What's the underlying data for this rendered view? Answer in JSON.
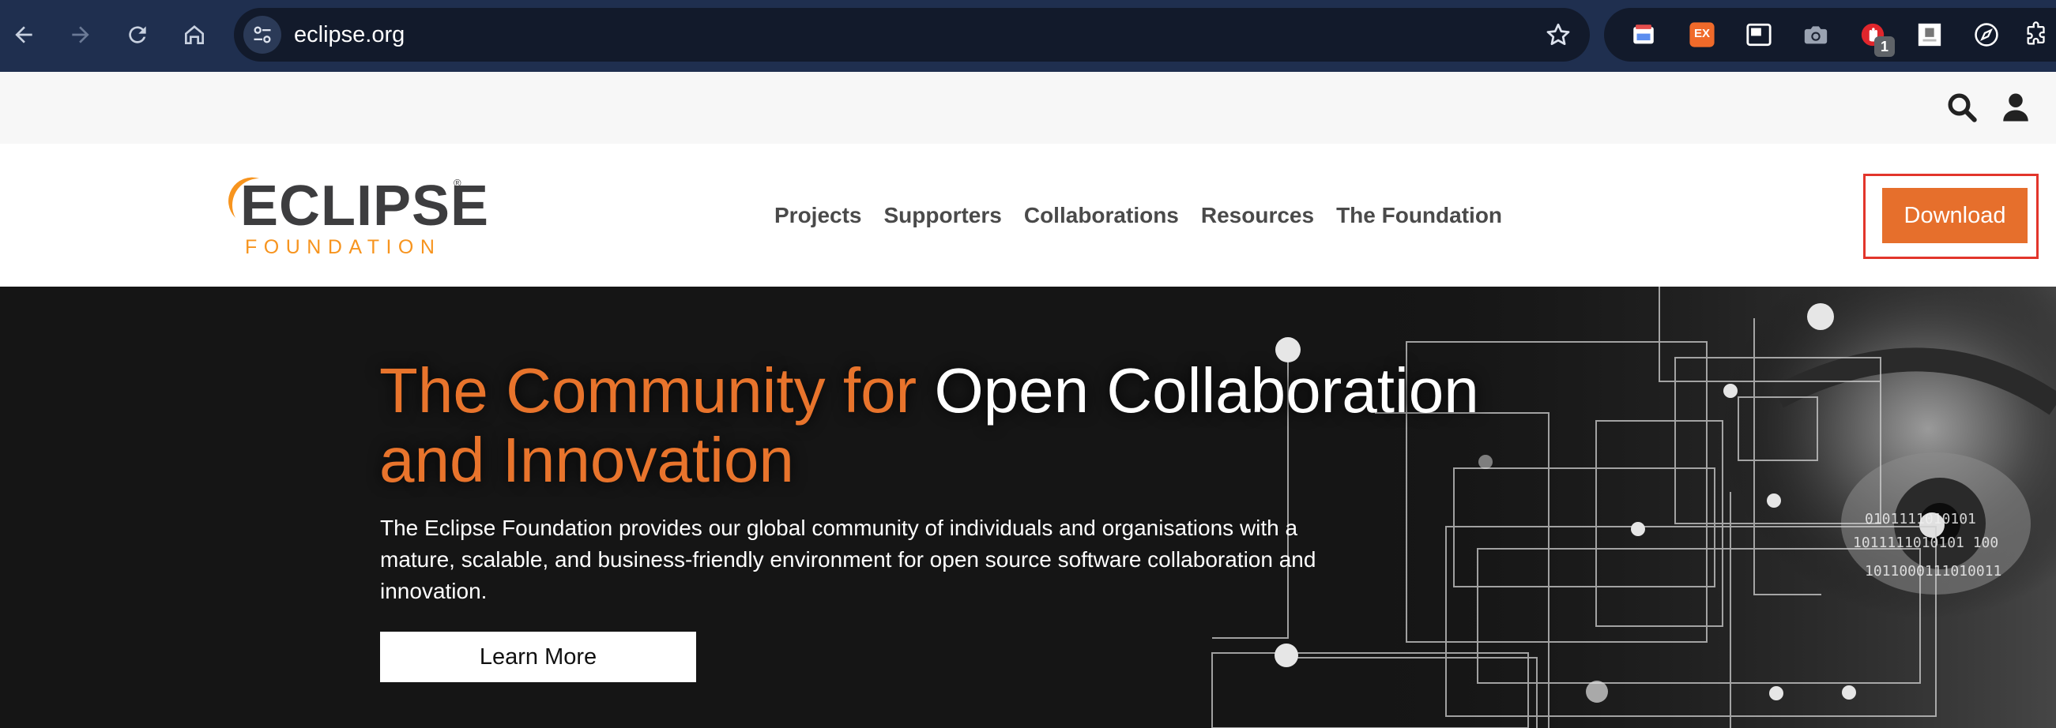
{
  "browser": {
    "url": "eclipse.org",
    "extension_badge": "1",
    "extension_ex_label": "EX"
  },
  "header": {
    "logo_main": "ECLIPSE",
    "logo_sub": "FOUNDATION",
    "logo_mark": "®",
    "nav": [
      "Projects",
      "Supporters",
      "Collaborations",
      "Resources",
      "The Foundation"
    ],
    "download_label": "Download"
  },
  "hero": {
    "title_orange_1": "The Community for",
    "title_white": "Open Collaboration",
    "title_orange_2": "and Innovation",
    "description": "The Eclipse Foundation provides our global community of individuals and organisations with a mature, scalable, and business-friendly environment for open source software collaboration and innovation.",
    "cta_label": "Learn More",
    "binary_text_1": "0101111010101",
    "binary_text_2": "1011111010101 100",
    "binary_text_3": "1011000111010011"
  },
  "colors": {
    "chrome_bg": "#1f2f4f",
    "accent_orange": "#e66f2c",
    "logo_orange": "#f7941e",
    "highlight_red": "#e2352b"
  },
  "icons": [
    "back-icon",
    "forward-icon",
    "reload-icon",
    "home-icon",
    "site-settings-icon",
    "bookmark-star-icon",
    "search-icon",
    "user-icon"
  ]
}
